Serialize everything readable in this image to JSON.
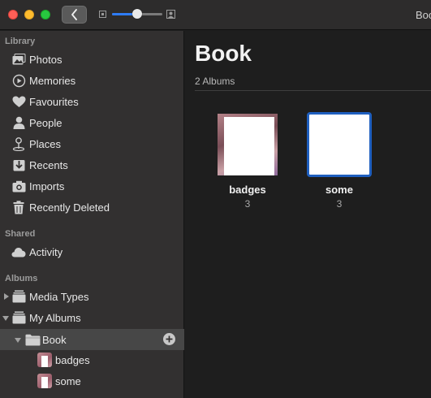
{
  "window": {
    "title": "Boo"
  },
  "toolbar": {
    "back_icon": "chevron-left-icon",
    "zoom_level": 0.5,
    "accent": "#2e7cf6"
  },
  "sidebar": {
    "library_title": "Library",
    "library_items": [
      {
        "label": "Photos",
        "icon": "photos-icon"
      },
      {
        "label": "Memories",
        "icon": "memories-icon"
      },
      {
        "label": "Favourites",
        "icon": "heart-icon"
      },
      {
        "label": "People",
        "icon": "person-icon"
      },
      {
        "label": "Places",
        "icon": "pin-icon"
      },
      {
        "label": "Recents",
        "icon": "recents-icon"
      },
      {
        "label": "Imports",
        "icon": "camera-icon"
      },
      {
        "label": "Recently Deleted",
        "icon": "trash-icon"
      }
    ],
    "shared_title": "Shared",
    "shared_items": [
      {
        "label": "Activity",
        "icon": "cloud-icon"
      }
    ],
    "albums_title": "Albums",
    "album_items": [
      {
        "label": "Media Types",
        "icon": "album-stack-icon"
      },
      {
        "label": "My Albums",
        "icon": "album-stack-icon"
      },
      {
        "label": "Book",
        "icon": "folder-icon"
      },
      {
        "label": "badges",
        "icon": "album-thumbnail"
      },
      {
        "label": "some",
        "icon": "album-thumbnail"
      }
    ]
  },
  "main": {
    "title": "Book",
    "album_count": "2 Albums",
    "albums": [
      {
        "name": "badges",
        "count": "3"
      },
      {
        "name": "some",
        "count": "3"
      }
    ]
  }
}
